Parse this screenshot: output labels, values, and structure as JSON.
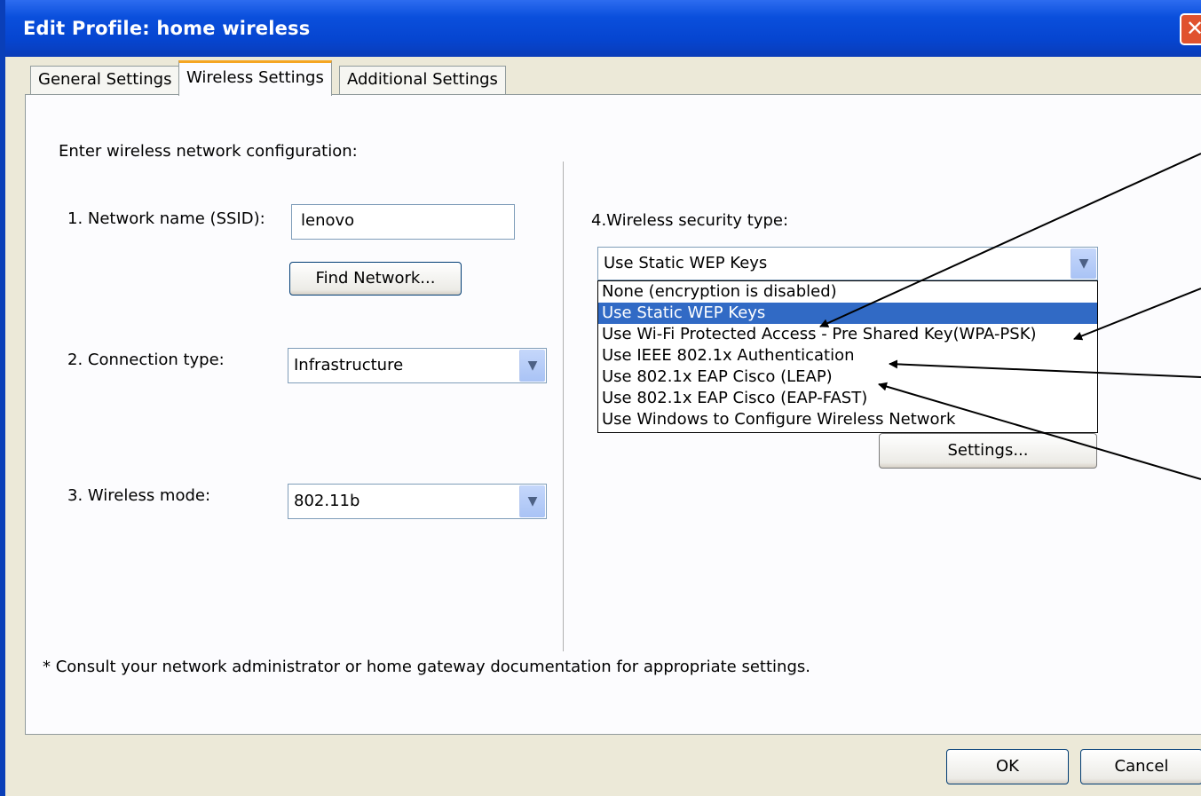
{
  "window": {
    "title": "Edit Profile: home wireless",
    "close_glyph": "✕"
  },
  "tabs": [
    {
      "label": "General Settings",
      "active": false
    },
    {
      "label": "Wireless Settings",
      "active": true
    },
    {
      "label": "Additional Settings",
      "active": false
    }
  ],
  "form": {
    "intro": "Enter wireless network configuration:",
    "ssid": {
      "label": "1. Network name (SSID):",
      "value": "lenovo"
    },
    "find_button": "Find Network...",
    "connection": {
      "label": "2. Connection type:",
      "value": "Infrastructure"
    },
    "mode": {
      "label": "3. Wireless mode:",
      "value": "802.11b"
    },
    "security": {
      "label": "4.Wireless security type:",
      "value": "Use Static WEP Keys",
      "options": [
        "None (encryption is disabled)",
        "Use Static WEP Keys",
        "Use Wi-Fi Protected Access - Pre Shared Key(WPA-PSK)",
        "Use IEEE 802.1x Authentication",
        "Use 802.1x EAP Cisco (LEAP)",
        "Use 802.1x EAP Cisco (EAP-FAST)",
        "Use Windows to Configure Wireless Network"
      ],
      "selected_index": 1
    },
    "settings_button": "Settings...",
    "footnote": "* Consult your network administrator or home gateway documentation for appropriate settings."
  },
  "footer": {
    "ok": "OK",
    "cancel": "Cancel"
  },
  "icons": {
    "dropdown": "chevron-down-icon",
    "close": "close-icon"
  },
  "colors": {
    "titlebar": "#0a4fdc",
    "selection": "#316ac5",
    "tab_highlight": "#f5a623"
  }
}
